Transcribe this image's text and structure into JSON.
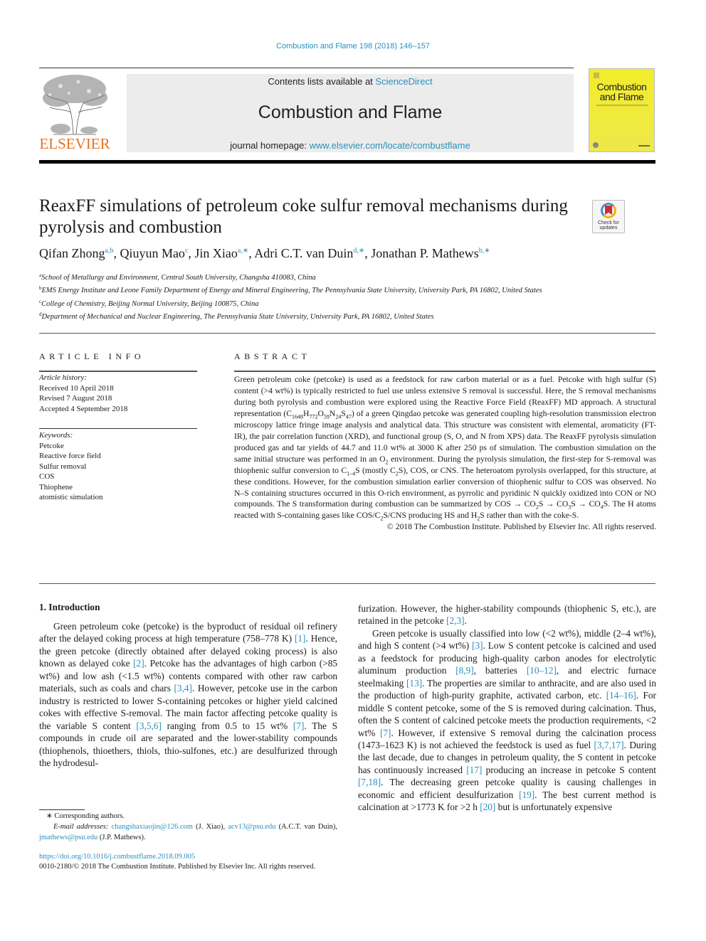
{
  "journal_ref": "Combustion and Flame 198 (2018) 146–157",
  "header": {
    "publisher_logo_text": "ELSEVIER",
    "contents_prefix": "Contents lists available at ",
    "contents_link": "ScienceDirect",
    "journal_title": "Combustion and Flame",
    "homepage_prefix": "journal homepage: ",
    "homepage_link": "www.elsevier.com/locate/combustflame",
    "cover_title_line1": "Combustion",
    "cover_title_line2": "and Flame"
  },
  "article": {
    "title": "ReaxFF simulations of petroleum coke sulfur removal mechanisms during pyrolysis and combustion",
    "check_updates_label_line1": "Check for",
    "check_updates_label_line2": "updates",
    "authors": [
      {
        "name": "Qifan Zhong",
        "sup": "a,b"
      },
      {
        "name": "Qiuyun Mao",
        "sup": "c"
      },
      {
        "name": "Jin Xiao",
        "sup": "a,∗"
      },
      {
        "name": "Adri C.T. van Duin",
        "sup": "d,∗"
      },
      {
        "name": "Jonathan P. Mathews",
        "sup": "b,∗"
      }
    ],
    "affiliations": [
      {
        "key": "a",
        "text": "School of Metallurgy and Environment, Central South University, Changsha 410083, China"
      },
      {
        "key": "b",
        "text": "EMS Energy Institute and Leone Family Department of Energy and Mineral Engineering, The Pennsylvania State University, University Park, PA 16802, United States"
      },
      {
        "key": "c",
        "text": "College of Chemistry, Beijing Normal University, Beijing 100875, China"
      },
      {
        "key": "d",
        "text": "Department of Mechanical and Nuclear Engineering, The Pennsylvania State University, University Park, PA 16802, United States"
      }
    ]
  },
  "article_info": {
    "heading": "ARTICLE INFO",
    "history_label": "Article history:",
    "history": [
      "Received 10 April 2018",
      "Revised 7 August 2018",
      "Accepted 4 September 2018"
    ],
    "keywords_label": "Keywords:",
    "keywords": [
      "Petcoke",
      "Reactive force field",
      "Sulfur removal",
      "COS",
      "Thiophene",
      "atomistic simulation"
    ]
  },
  "abstract": {
    "heading": "ABSTRACT",
    "p1": "Green petroleum coke (petcoke) is used as a feedstock for raw carbon material or as a fuel. Petcoke with high sulfur (S) content (>4 wt%) is typically restricted to fuel use unless extensive S removal is successful. Here, the S removal mechanisms during both pyrolysis and combustion were explored using the Reactive Force Field (ReaxFF) MD approach. A structural representation (",
    "formula": {
      "C": "1648",
      "H": "772",
      "O": "59",
      "N": "24",
      "S": "47"
    },
    "p2": ") of a green Qingdao petcoke was generated coupling high-resolution transmission electron microscopy lattice fringe image analysis and analytical data. This structure was consistent with elemental, aromaticity (FT-IR), the pair correlation function (XRD), and functional group (S, O, and N from XPS) data. The ReaxFF pyrolysis simulation produced gas and tar yields of 44.7 and 11.0 wt% at 3000 K after 250 ps of simulation. The combustion simulation on the same initial structure was performed in an O",
    "p3": " environment. During the pyrolysis simulation, the first-step for S-removal was thiophenic sulfur conversion to C",
    "p4": "S (mostly C",
    "p5": "S), COS, or CNS. The heteroatom pyrolysis overlapped, for this structure, at these conditions. However, for the combustion simulation earlier conversion of thiophenic sulfur to COS was observed. No N–S containing structures occurred in this O-rich environment, as pyrrolic and pyridinic N quickly oxidized into CON or NO compounds. The S transformation during combustion can be summarized by COS → CO",
    "p6": "S → CO",
    "p7": "S → CO",
    "p8": "S. The H atoms reacted with S-containing gases like COS/C",
    "p9": "S/CNS producing HS and H",
    "p10": "S rather than with the coke-S.",
    "subs": {
      "o2": "2",
      "c14": "1–4",
      "c2": "2",
      "co2": "2",
      "co3": "3",
      "co4": "4",
      "c2b": "2",
      "h2": "2"
    },
    "copyright": "© 2018 The Combustion Institute. Published by Elsevier Inc. All rights reserved."
  },
  "body": {
    "section_heading": "1. Introduction",
    "left_p1": [
      {
        "t": "Green petroleum coke (petcoke) is the byproduct of residual oil refinery after the delayed coking process at high temperature (758–778 K) "
      },
      {
        "r": "[1]"
      },
      {
        "t": ". Hence, the green petcoke (directly obtained after delayed coking process) is also known as delayed coke "
      },
      {
        "r": "[2]"
      },
      {
        "t": ". Petcoke has the advantages of high carbon (>85 wt%) and low ash (<1.5 wt%) contents compared with other raw carbon materials, such as coals and chars "
      },
      {
        "r": "[3,4]"
      },
      {
        "t": ". However, petcoke use in the carbon industry is restricted to lower S-containing petcokes or higher yield calcined cokes with effective S-removal. The main factor affecting petcoke quality is the variable S content "
      },
      {
        "r": "[3,5,6]"
      },
      {
        "t": " ranging from 0.5 to 15 wt% "
      },
      {
        "r": "[7]"
      },
      {
        "t": ". The S compounds in crude oil are separated and the lower-stability compounds (thiophenols, thioethers, thiols, thio-sulfones, etc.) are desulfurized through the hydrodesul-"
      }
    ],
    "right_p1": [
      {
        "t": "furization. However, the higher-stability compounds (thiophenic S, etc.), are retained in the petcoke "
      },
      {
        "r": "[2,3]"
      },
      {
        "t": "."
      }
    ],
    "right_p2": [
      {
        "t": "Green petcoke is usually classified into low (<2 wt%), middle (2–4 wt%), and high S content (>4 wt%) "
      },
      {
        "r": "[3]"
      },
      {
        "t": ". Low S content petcoke is calcined and used as a feedstock for producing high-quality carbon anodes for electrolytic aluminum production "
      },
      {
        "r": "[8,9]"
      },
      {
        "t": ", batteries "
      },
      {
        "r": "[10–12]"
      },
      {
        "t": ", and electric furnace steelmaking "
      },
      {
        "r": "[13]"
      },
      {
        "t": ". The properties are similar to anthracite, and are also used in the production of high-purity graphite, activated carbon, etc. "
      },
      {
        "r": "[14–16]"
      },
      {
        "t": ". For middle S content petcoke, some of the S is removed during calcination. Thus, often the S content of calcined petcoke meets the production requirements, <2 wt% "
      },
      {
        "r": "[7]"
      },
      {
        "t": ". However, if extensive S removal during the calcination process (1473–1623 K) is not achieved the feedstock is used as fuel "
      },
      {
        "r": "[3,7,17]"
      },
      {
        "t": ". During the last decade, due to changes in petroleum quality, the S content in petcoke has continuously increased "
      },
      {
        "r": "[17]"
      },
      {
        "t": " producing an increase in petcoke S content "
      },
      {
        "r": "[7,18]"
      },
      {
        "t": ". The decreasing green petcoke quality is causing challenges in economic and efficient desulfurization "
      },
      {
        "r": "[19]"
      },
      {
        "t": ". The best current method is calcination at >1773 K for >2 h "
      },
      {
        "r": "[20]"
      },
      {
        "t": " but is unfortunately expensive"
      }
    ]
  },
  "footnotes": {
    "corresponding": "∗ Corresponding authors.",
    "email_label": "E-mail addresses: ",
    "emails": [
      {
        "addr": "changshaxiaojin@126.com",
        "who": " (J. Xiao), "
      },
      {
        "addr": "acv13@psu.edu",
        "who": " (A.C.T. van Duin), "
      },
      {
        "addr": "jmathews@psu.edu",
        "who": " (J.P. Mathews)."
      }
    ],
    "doi": "https://doi.org/10.1016/j.combustflame.2018.09.005",
    "issn_copyright": "0010-2180/© 2018 The Combustion Institute. Published by Elsevier Inc. All rights reserved."
  },
  "colors": {
    "link": "#2a8fbd",
    "elsevier_orange": "#e9711c",
    "cover_yellow": "#f3ec2a"
  }
}
